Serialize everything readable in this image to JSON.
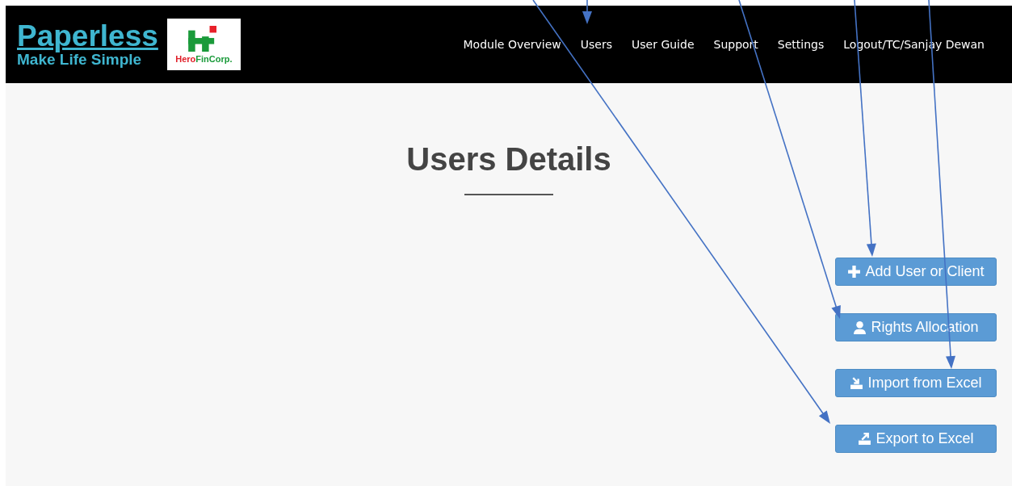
{
  "brand": {
    "title": "Paperless",
    "tagline": "Make Life Simple",
    "partner_logo": {
      "text_red": "Hero",
      "text_green": "FinCorp."
    }
  },
  "nav": [
    "Module Overview",
    "Users",
    "User Guide",
    "Support",
    "Settings",
    "Logout/TC/Sanjay Dewan"
  ],
  "page": {
    "title": "Users Details"
  },
  "actions": [
    {
      "label": "Add User or Client",
      "kind": "plus"
    },
    {
      "label": "Rights Allocation",
      "kind": "user"
    },
    {
      "label": "Import from Excel",
      "kind": "import"
    },
    {
      "label": "Export to Excel",
      "kind": "export"
    }
  ]
}
